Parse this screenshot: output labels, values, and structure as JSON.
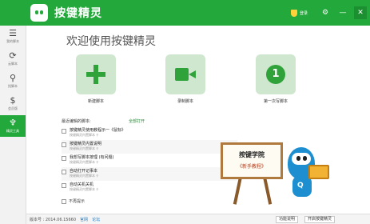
{
  "app": {
    "title": "按键精灵",
    "user_label": "登录",
    "window_controls": [
      "gear-icon",
      "minimize-icon",
      "close-icon"
    ]
  },
  "sidebar": {
    "items": [
      {
        "icon": "☰",
        "icon_name": "menu-list-icon",
        "label": "我的脚本"
      },
      {
        "icon": "⟳",
        "icon_name": "cloud-sync-icon",
        "label": "云脚本"
      },
      {
        "icon": "⚲",
        "icon_name": "search-icon",
        "label": "找脚本"
      },
      {
        "icon": "$",
        "icon_name": "dollar-icon",
        "label": "会员版"
      },
      {
        "icon": "♆",
        "icon_name": "tools-icon",
        "label": "精灵工具",
        "active": true
      }
    ]
  },
  "main": {
    "welcome": "欢迎使用按键精灵",
    "actions": [
      {
        "label": "新建脚本",
        "icon_name": "plus-icon"
      },
      {
        "label": "录制脚本",
        "icon_name": "video-camera-icon"
      },
      {
        "label": "第一次写脚本",
        "icon_name": "number-one-icon"
      }
    ],
    "recent_header": "最近编辑的脚本:",
    "recent_open": "全部打开",
    "scripts": [
      {
        "name": "按键精灵使用教程示一《鼠标》",
        "path": "按键精灵内置脚本 ⚲"
      },
      {
        "name": "按键精灵内置说明",
        "path": "按键精灵内置脚本 ⚲"
      },
      {
        "name": "我想写脚本按理 (有问题)",
        "path": "按键精灵内置脚本 ⚲"
      },
      {
        "name": "自动打开记事本",
        "path": "按键精灵内置脚本 ⚲"
      },
      {
        "name": "自动关机关机",
        "path": "按键精灵内置脚本 ⚲"
      }
    ],
    "bottom_checkbox": "不再提示"
  },
  "promo": {
    "title": "按键学院",
    "subtitle": "《新手教程》",
    "mascot_letter": "Q"
  },
  "statusbar": {
    "version": "版本号 : 2014.06.15660",
    "links": [
      "官网",
      "论坛"
    ],
    "buttons": [
      "功能说明",
      "开启按键精灵"
    ]
  },
  "colors": {
    "accent": "#23a83b",
    "tile_bg": "#cfe6cf",
    "icon_green": "#2fa33a"
  }
}
